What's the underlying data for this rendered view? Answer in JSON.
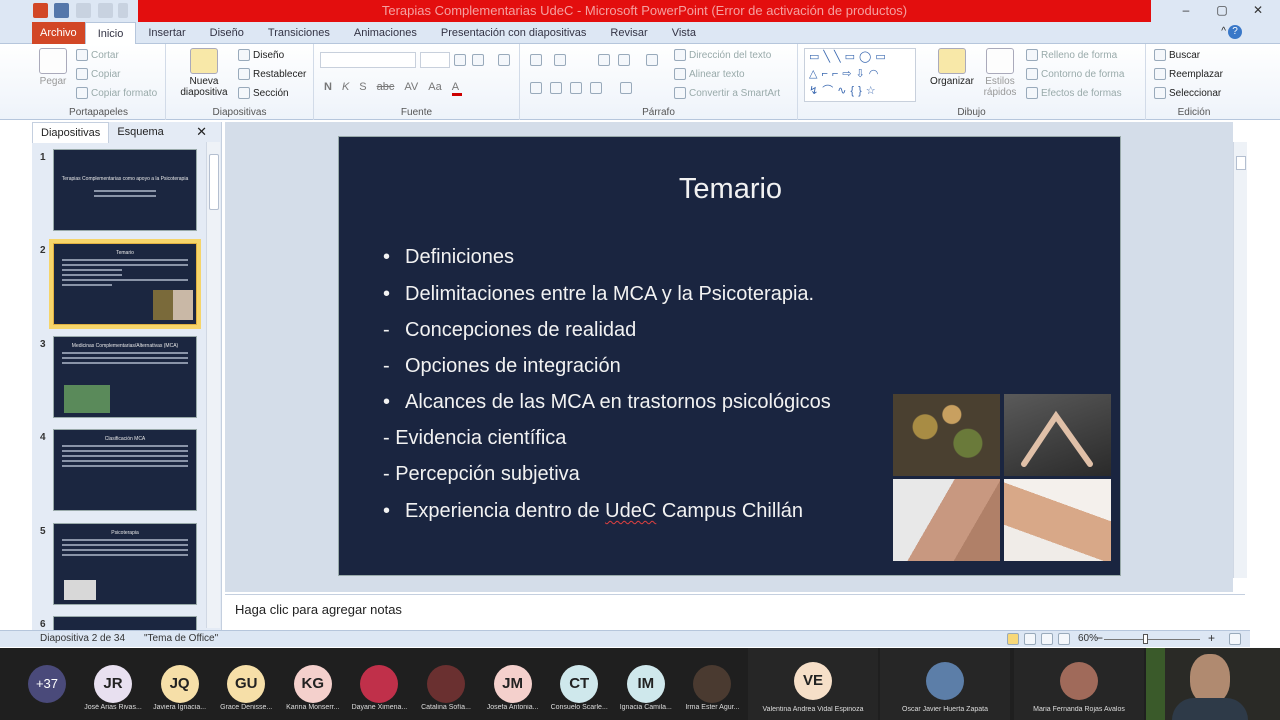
{
  "app": {
    "window_title": "Terapias Complementarias UdeC - Microsoft PowerPoint (Error de activación de productos)"
  },
  "ribbon_tabs": [
    "Archivo",
    "Inicio",
    "Insertar",
    "Diseño",
    "Transiciones",
    "Animaciones",
    "Presentación con diapositivas",
    "Revisar",
    "Vista"
  ],
  "ribbon": {
    "portapapeles": {
      "label": "Portapapeles",
      "pegar": "Pegar",
      "cortar": "Cortar",
      "copiar": "Copiar",
      "copiar_formato": "Copiar formato"
    },
    "diapositivas": {
      "label": "Diapositivas",
      "nueva": "Nueva",
      "diapositiva": "diapositiva",
      "diseno": "Diseño",
      "restablecer": "Restablecer",
      "seccion": "Sección"
    },
    "fuente": {
      "label": "Fuente",
      "bold": "N",
      "italic": "K",
      "shadow": "S",
      "strike": "abc",
      "spacing": "AV",
      "case": "Aa"
    },
    "parrafo": {
      "label": "Párrafo",
      "direccion": "Dirección del texto",
      "alinear": "Alinear texto",
      "smartart": "Convertir a SmartArt"
    },
    "dibujo": {
      "label": "Dibujo",
      "organizar": "Organizar",
      "estilos": "Estilos",
      "rapidos": "rápidos",
      "relleno": "Relleno de forma",
      "contorno": "Contorno de forma",
      "efectos": "Efectos de formas"
    },
    "edicion": {
      "label": "Edición",
      "buscar": "Buscar",
      "reemplazar": "Reemplazar",
      "seleccionar": "Seleccionar"
    }
  },
  "left_pane": {
    "tabs": [
      "Diapositivas",
      "Esquema"
    ],
    "thumbnails": [
      {
        "num": "1",
        "title": "Terapias Complementarias como apoyo a la Psicoterapia"
      },
      {
        "num": "2",
        "title": "Temario"
      },
      {
        "num": "3",
        "title": "Medicinas Complementarias/Alternativas (MCA)"
      },
      {
        "num": "4",
        "title": "Clasificación MCA"
      },
      {
        "num": "5",
        "title": "Psicoterapia"
      },
      {
        "num": "6",
        "title": ""
      }
    ]
  },
  "slide": {
    "title": "Temario",
    "bullets": [
      {
        "marker": "•",
        "text": "Definiciones"
      },
      {
        "marker": "•",
        "text": "Delimitaciones entre la MCA y la Psicoterapia."
      },
      {
        "marker": "-",
        "text": "Concepciones de realidad"
      },
      {
        "marker": "-",
        "text": "Opciones de integración"
      },
      {
        "marker": "•",
        "text": "Alcances de las MCA en trastornos psicológicos"
      },
      {
        "marker": "",
        "text": "- Evidencia científica"
      },
      {
        "marker": "",
        "text": "- Percepción subjetiva"
      },
      {
        "marker": "•",
        "text_prefix": "Experiencia dentro de ",
        "text_underlined": "UdeC",
        "text_suffix": " Campus Chillán"
      }
    ]
  },
  "notes_placeholder": "Haga clic para agregar notas",
  "status": {
    "slide_counter": "Diapositiva 2 de 34",
    "theme": "\"Tema de Office\"",
    "zoom": "60%"
  },
  "participants": {
    "more_count": "+37",
    "list": [
      {
        "initials": "JR",
        "name": "José Arias Rivas...",
        "color": "#e8e0f0"
      },
      {
        "initials": "JQ",
        "name": "Javiera Ignacia...",
        "color": "#f6dfa8"
      },
      {
        "initials": "GU",
        "name": "Grace Denisse...",
        "color": "#f6dfa8"
      },
      {
        "initials": "KG",
        "name": "Karina Monserr...",
        "color": "#f4d0cc"
      },
      {
        "initials": "",
        "name": "Dayane Ximena...",
        "color": "#c0304a"
      },
      {
        "initials": "",
        "name": "Catalina Sofía...",
        "color": "#6a3030"
      },
      {
        "initials": "JM",
        "name": "Josefa Antonia...",
        "color": "#f4d0cc"
      },
      {
        "initials": "CT",
        "name": "Consuelo Scarle...",
        "color": "#cfe8ec"
      },
      {
        "initials": "IM",
        "name": "Ignacia Camila...",
        "color": "#cfe8ec"
      },
      {
        "initials": "",
        "name": "Irma Ester Agur...",
        "color": "#4a3a30"
      }
    ],
    "highlighted": [
      {
        "initials": "VE",
        "name": "Valentina Andrea Vidal Espinoza",
        "color": "#f6dfc8"
      },
      {
        "initials": "",
        "name": "Oscar Javier Huerta Zapata",
        "color": "#5c7ea8"
      },
      {
        "initials": "",
        "name": "Maria Fernanda Rojas Avalos",
        "color": "#a06a5a"
      }
    ]
  },
  "colors": {
    "accent_file": "#d24726",
    "titlebar_red": "#e30e0e",
    "slide_bg": "#1a2540"
  }
}
